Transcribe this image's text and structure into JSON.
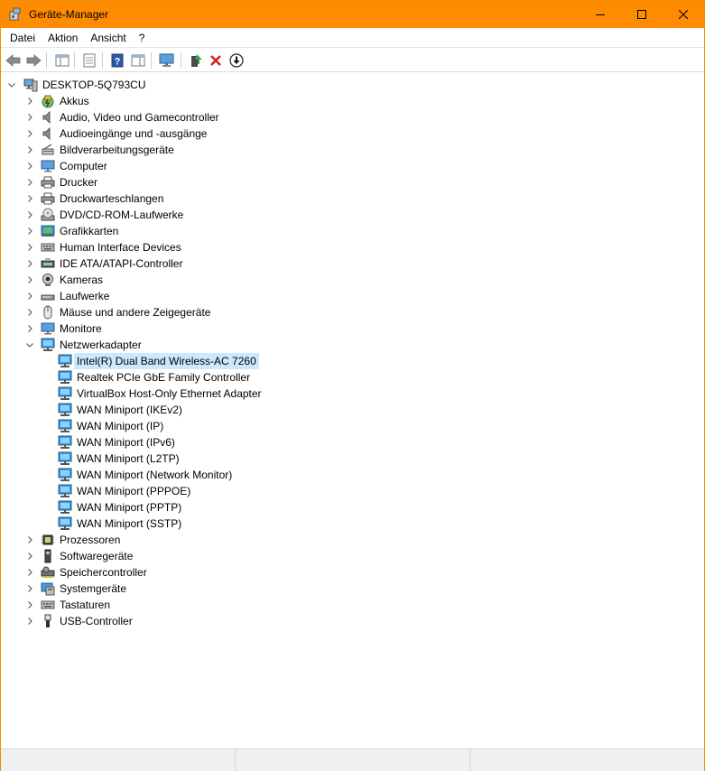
{
  "window": {
    "title": "Geräte-Manager"
  },
  "menu": [
    "Datei",
    "Aktion",
    "Ansicht",
    "?"
  ],
  "toolbar": [
    {
      "name": "back-button",
      "icon": "arrow-left-icon"
    },
    {
      "name": "forward-button",
      "icon": "arrow-right-icon"
    },
    {
      "name": "show-hide-tree-button",
      "icon": "console-tree-icon"
    },
    {
      "name": "properties-button",
      "icon": "properties-icon"
    },
    {
      "name": "help-button",
      "icon": "help-icon"
    },
    {
      "name": "action-pane-button",
      "icon": "action-pane-icon"
    },
    {
      "name": "scan-hardware-button",
      "icon": "monitor-scan-icon"
    },
    {
      "name": "update-driver-button",
      "icon": "update-driver-icon"
    },
    {
      "name": "uninstall-device-button",
      "icon": "red-x-icon"
    },
    {
      "name": "disable-device-button",
      "icon": "down-arrow-circle-icon"
    }
  ],
  "tree": {
    "root": "DESKTOP-5Q793CU",
    "categories_before": [
      {
        "label": "Akkus",
        "icon": "battery-icon"
      },
      {
        "label": "Audio, Video und Gamecontroller",
        "icon": "speaker-icon"
      },
      {
        "label": "Audioeingänge und -ausgänge",
        "icon": "speaker-icon"
      },
      {
        "label": "Bildverarbeitungsgeräte",
        "icon": "scanner-icon"
      },
      {
        "label": "Computer",
        "icon": "monitor-icon"
      },
      {
        "label": "Drucker",
        "icon": "printer-icon"
      },
      {
        "label": "Druckwarteschlangen",
        "icon": "printer-icon"
      },
      {
        "label": "DVD/CD-ROM-Laufwerke",
        "icon": "disc-drive-icon"
      },
      {
        "label": "Grafikkarten",
        "icon": "display-adapter-icon"
      },
      {
        "label": "Human Interface Devices",
        "icon": "keyboard-icon"
      },
      {
        "label": "IDE ATA/ATAPI-Controller",
        "icon": "ide-controller-icon"
      },
      {
        "label": "Kameras",
        "icon": "camera-icon"
      },
      {
        "label": "Laufwerke",
        "icon": "drive-icon"
      },
      {
        "label": "Mäuse und andere Zeigegeräte",
        "icon": "mouse-icon"
      },
      {
        "label": "Monitore",
        "icon": "monitor-icon"
      }
    ],
    "network": {
      "label": "Netzwerkadapter",
      "icon": "network-adapter-icon",
      "children": [
        "Intel(R) Dual Band Wireless-AC 7260",
        "Realtek PCIe GbE Family Controller",
        "VirtualBox Host-Only Ethernet Adapter",
        "WAN Miniport (IKEv2)",
        "WAN Miniport (IP)",
        "WAN Miniport (IPv6)",
        "WAN Miniport (L2TP)",
        "WAN Miniport (Network Monitor)",
        "WAN Miniport (PPPOE)",
        "WAN Miniport (PPTP)",
        "WAN Miniport (SSTP)"
      ],
      "selected_index": 0
    },
    "categories_after": [
      {
        "label": "Prozessoren",
        "icon": "processor-icon"
      },
      {
        "label": "Softwaregeräte",
        "icon": "software-device-icon"
      },
      {
        "label": "Speichercontroller",
        "icon": "storage-controller-icon"
      },
      {
        "label": "Systemgeräte",
        "icon": "system-device-icon"
      },
      {
        "label": "Tastaturen",
        "icon": "keyboard-icon"
      },
      {
        "label": "USB-Controller",
        "icon": "usb-icon"
      }
    ]
  },
  "colors": {
    "titlebar": "#ff8c00",
    "selection": "#cce8ff"
  }
}
